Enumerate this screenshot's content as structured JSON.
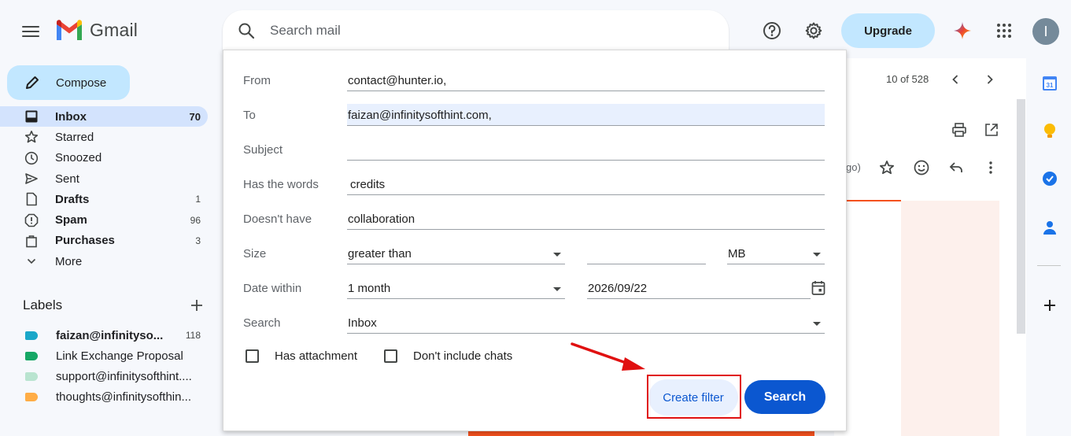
{
  "header": {
    "app_name": "Gmail",
    "search_placeholder": "Search mail",
    "upgrade_label": "Upgrade",
    "avatar_letter": "I"
  },
  "sidebar": {
    "compose_label": "Compose",
    "items": [
      {
        "label": "Inbox",
        "count": "70",
        "icon": "inbox-icon",
        "active": true,
        "bold": true
      },
      {
        "label": "Starred",
        "count": "",
        "icon": "star-icon"
      },
      {
        "label": "Snoozed",
        "count": "",
        "icon": "clock-icon"
      },
      {
        "label": "Sent",
        "count": "",
        "icon": "send-icon"
      },
      {
        "label": "Drafts",
        "count": "1",
        "icon": "draft-icon",
        "bold": true
      },
      {
        "label": "Spam",
        "count": "96",
        "icon": "spam-icon",
        "bold": true
      },
      {
        "label": "Purchases",
        "count": "3",
        "icon": "bag-icon",
        "bold": true
      },
      {
        "label": "More",
        "count": "",
        "icon": "chevron-down-icon"
      }
    ],
    "labels_heading": "Labels",
    "labels": [
      {
        "label": "faizan@infinityso...",
        "count": "118",
        "color": "#1aa7c9",
        "bold": true
      },
      {
        "label": "Link Exchange Proposal",
        "count": "",
        "color": "#16a765"
      },
      {
        "label": "support@infinitysofthint....",
        "count": "",
        "color": "#b9e4d0"
      },
      {
        "label": "thoughts@infinitysofthin...",
        "count": "",
        "color": "#ffad46"
      }
    ]
  },
  "message_view": {
    "pager": "10 of 528",
    "time_fragment": "go)"
  },
  "filter": {
    "from_label": "From",
    "from_value": "contact@hunter.io,",
    "to_label": "To",
    "to_value": "faizan@infinitysofthint.com,",
    "subject_label": "Subject",
    "subject_value": "",
    "has_words_label": "Has the words",
    "has_words_value": "credits",
    "doesnt_have_label": "Doesn't have",
    "doesnt_have_value": "collaboration",
    "size_label": "Size",
    "size_operator": "greater than",
    "size_value": "",
    "size_unit": "MB",
    "date_label": "Date within",
    "date_range": "1 month",
    "date_value": "2026/09/22",
    "search_label": "Search",
    "search_scope": "Inbox",
    "has_attachment_label": "Has attachment",
    "no_chats_label": "Don't include chats",
    "create_filter_label": "Create filter",
    "search_button_label": "Search"
  },
  "colors": {
    "accent": "#0b57d0",
    "highlight": "#e01010",
    "upgrade_bg": "#c2e7ff"
  }
}
